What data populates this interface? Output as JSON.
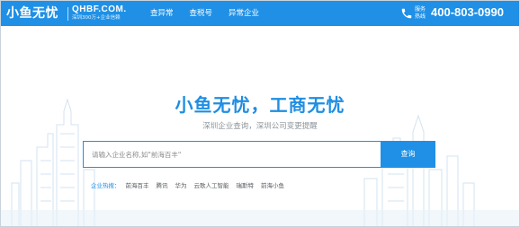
{
  "header": {
    "logo_cn": "小鱼无忧",
    "logo_en": "QHBF.COM.",
    "logo_tagline": "深圳300万+企业信赖",
    "nav": [
      {
        "label": "查异常"
      },
      {
        "label": "查税号"
      },
      {
        "label": "异常企业"
      }
    ],
    "hotline_label": "服务热线",
    "phone": "400-803-0990",
    "phone_icon": "phone-icon"
  },
  "hero": {
    "title": "小鱼无忧，工商无忧",
    "subtitle": "深圳企业查询，深圳公司变更提醒"
  },
  "search": {
    "placeholder": "请输入企业名称,如\"前海百丰\"",
    "button_label": "查询"
  },
  "hot": {
    "label": "企业热搜：",
    "items": [
      "前海百丰",
      "腾讯",
      "华为",
      "云歌人工智能",
      "瑞斯特",
      "前海小鱼"
    ]
  },
  "colors": {
    "brand_blue": "#1f90e6",
    "title_blue": "#1f8ee3",
    "skyline": "#d6e6f3"
  }
}
